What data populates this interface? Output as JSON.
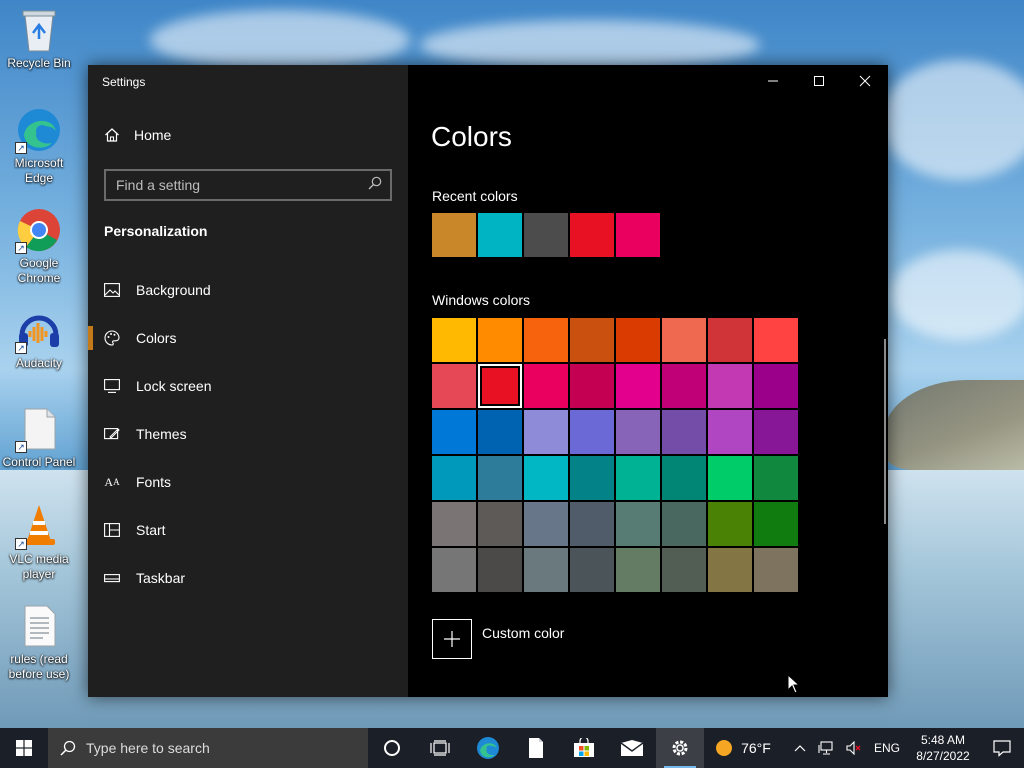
{
  "desktop": {
    "icons": [
      {
        "label": "Recycle Bin",
        "icon": "recycle-bin-icon"
      },
      {
        "label": "Microsoft Edge",
        "icon": "edge-icon"
      },
      {
        "label": "Google Chrome",
        "icon": "chrome-icon"
      },
      {
        "label": "Audacity",
        "icon": "audacity-icon"
      },
      {
        "label": "Control Panel",
        "icon": "control-panel-icon"
      },
      {
        "label": "VLC media player",
        "icon": "vlc-icon"
      },
      {
        "label": "rules (read before use)",
        "icon": "text-file-icon"
      }
    ]
  },
  "window": {
    "title": "Settings",
    "controls": {
      "minimize": "—",
      "maximize": "☐",
      "close": "✕"
    }
  },
  "sidebar": {
    "home_label": "Home",
    "search_placeholder": "Find a setting",
    "section": "Personalization",
    "items": [
      {
        "label": "Background",
        "icon": "background-icon",
        "active": false
      },
      {
        "label": "Colors",
        "icon": "palette-icon",
        "active": true
      },
      {
        "label": "Lock screen",
        "icon": "lock-screen-icon",
        "active": false
      },
      {
        "label": "Themes",
        "icon": "themes-icon",
        "active": false
      },
      {
        "label": "Fonts",
        "icon": "fonts-icon",
        "active": false
      },
      {
        "label": "Start",
        "icon": "start-icon",
        "active": false
      },
      {
        "label": "Taskbar",
        "icon": "taskbar-icon",
        "active": false
      }
    ]
  },
  "main": {
    "title": "Colors",
    "recent_label": "Recent colors",
    "recent_colors": [
      "#c9872a",
      "#00b4c4",
      "#4c4c4c",
      "#e81123",
      "#ea005e"
    ],
    "windows_label": "Windows colors",
    "windows_colors": [
      "#ffb900",
      "#ff8c00",
      "#f7630c",
      "#ca5010",
      "#da3b01",
      "#ef6950",
      "#d13438",
      "#ff4343",
      "#e74856",
      "#e81123",
      "#ea005e",
      "#c30052",
      "#e3008c",
      "#bf0077",
      "#c239b3",
      "#9a0089",
      "#0078d7",
      "#0063b1",
      "#8e8cd8",
      "#6b69d6",
      "#8764b8",
      "#744da9",
      "#b146c2",
      "#881798",
      "#0099bc",
      "#2d7d9a",
      "#00b7c3",
      "#038387",
      "#00b294",
      "#018574",
      "#00cc6a",
      "#10893e",
      "#7a7574",
      "#5d5a58",
      "#68768a",
      "#515c6b",
      "#567c73",
      "#486860",
      "#498205",
      "#107c10",
      "#767676",
      "#4c4a48",
      "#69797e",
      "#4a5459",
      "#647c64",
      "#525e54",
      "#847545",
      "#7e735f"
    ],
    "selected_index": 9,
    "custom_label": "Custom color"
  },
  "taskbar": {
    "search_placeholder": "Type here to search",
    "weather": "76°F",
    "language": "ENG",
    "time": "5:48 AM",
    "date": "8/27/2022"
  }
}
